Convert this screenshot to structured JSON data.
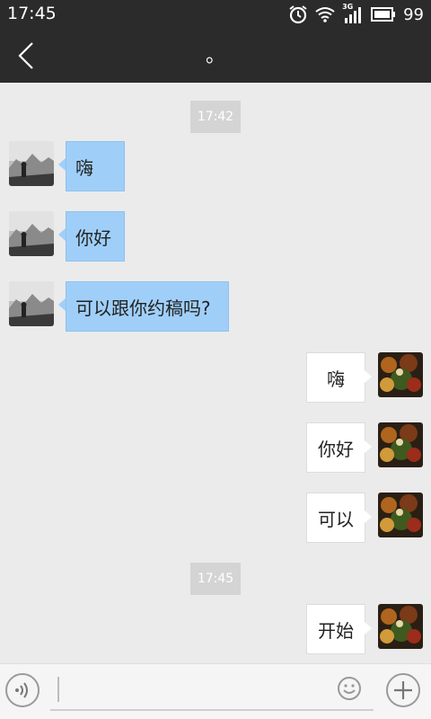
{
  "status_bar": {
    "time": "17:45",
    "network_label": "3G",
    "battery": "99",
    "icons": [
      "alarm-icon",
      "wifi-icon",
      "signal-icon",
      "battery-icon"
    ]
  },
  "header": {
    "title": "。",
    "back_icon": "back-chevron-icon"
  },
  "chat": {
    "timestamps": [
      "17:42",
      "17:45"
    ],
    "incoming": [
      {
        "text": "嗨"
      },
      {
        "text": "你好"
      },
      {
        "text": "可以跟你约稿吗?"
      }
    ],
    "outgoing": [
      {
        "text": "嗨"
      },
      {
        "text": "你好"
      },
      {
        "text": "可以"
      },
      {
        "text": "开始"
      }
    ]
  },
  "input_bar": {
    "placeholder": "",
    "icons": [
      "voice-icon",
      "emoji-icon",
      "plus-icon"
    ]
  },
  "colors": {
    "header_bg": "#2b2b2b",
    "chat_bg": "#ebebeb",
    "incoming_bubble": "#9fcff9",
    "outgoing_bubble": "#ffffff",
    "timestamp_chip": "#d4d4d4"
  }
}
